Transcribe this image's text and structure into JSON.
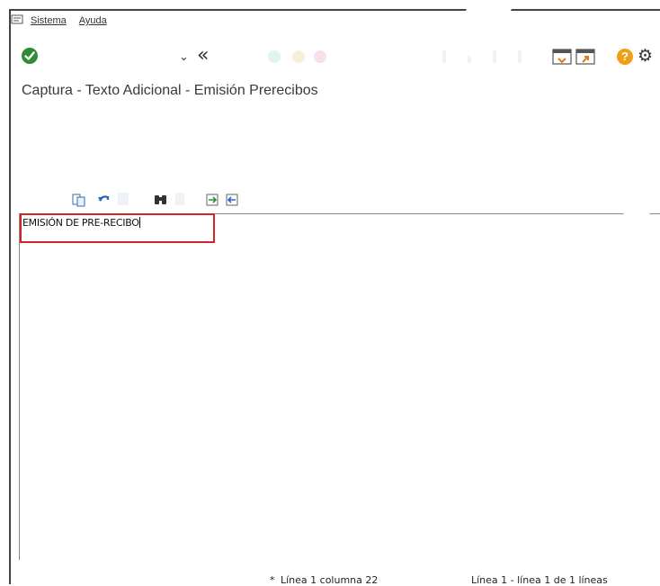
{
  "menu": {
    "items": [
      "Sistema",
      "Ayuda"
    ]
  },
  "toolbar": {
    "icons": [
      "check-icon",
      "dropdown-arrow-icon",
      "back-double-arrow-icon",
      "help-icon",
      "settings-icon"
    ]
  },
  "page": {
    "title": "Captura - Texto Adicional - Emisión Prerecibos"
  },
  "editor": {
    "text": "EMISIÓN DE PRE-RECIBO"
  },
  "status": {
    "cursor": "Línea 1 columna 22",
    "lines": "Línea 1 - línea 1 de 1 líneas",
    "marker": "*"
  },
  "colors": {
    "accent_red": "#d42428",
    "check_green": "#2f8c34",
    "help_orange": "#f0a018"
  }
}
